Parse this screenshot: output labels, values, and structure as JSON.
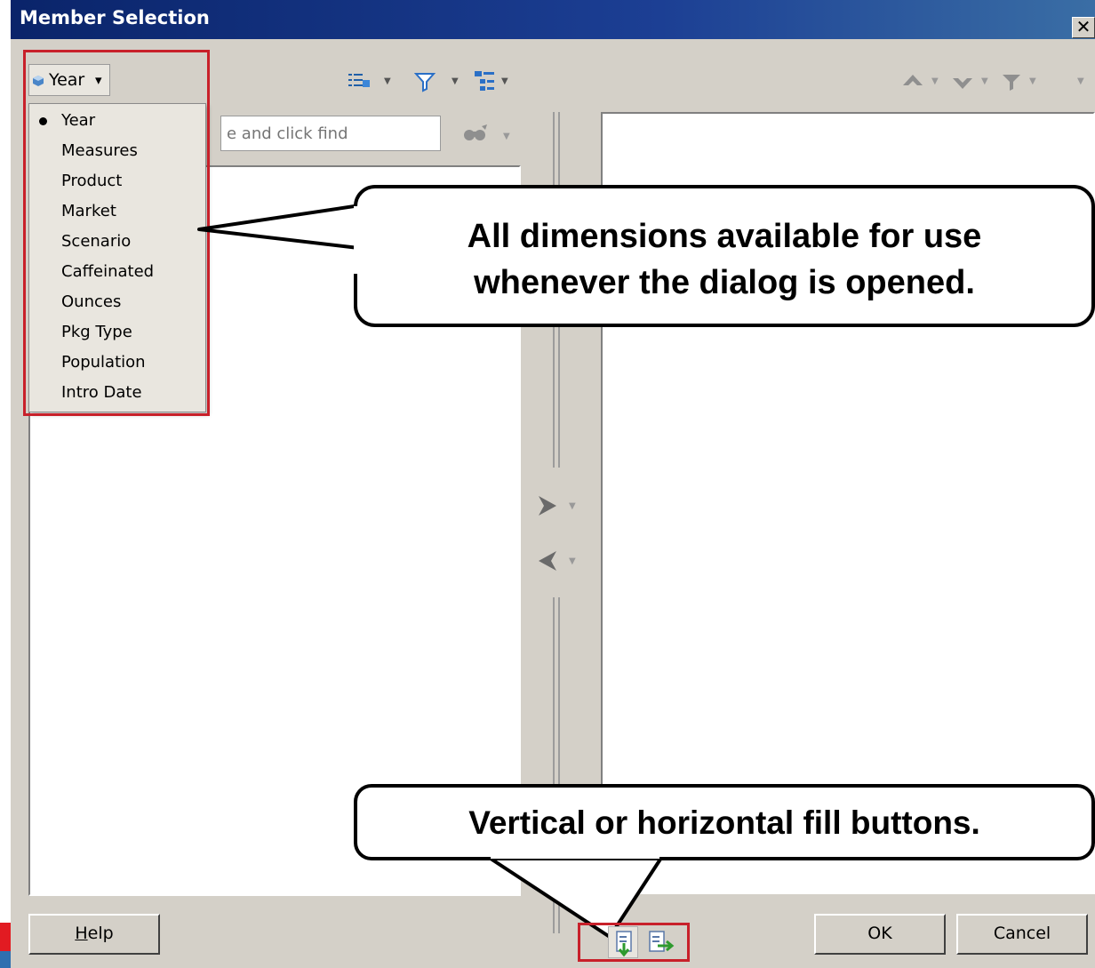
{
  "window": {
    "title": "Member Selection",
    "close_glyph": "✕"
  },
  "toolbar": {
    "dimension_button": "Year",
    "dimension_caret": "▾",
    "left_tools": [
      "view-icon",
      "filter-icon",
      "tree-icon"
    ],
    "right_tools": [
      "move-up-icon",
      "move-down-icon",
      "filter-icon"
    ]
  },
  "search": {
    "placeholder": "e and click find"
  },
  "dimension_menu": {
    "selected": "Year",
    "items": [
      "Year",
      "Measures",
      "Product",
      "Market",
      "Scenario",
      "Caffeinated",
      "Ounces",
      "Pkg Type",
      "Population",
      "Intro Date"
    ]
  },
  "callouts": {
    "dimensions_line1": "All dimensions available for use",
    "dimensions_line2": "whenever the dialog is opened.",
    "fill_buttons": "Vertical or horizontal fill buttons."
  },
  "buttons": {
    "help": "Help",
    "help_mnemonic": "H",
    "help_rest": "elp",
    "ok": "OK",
    "cancel": "Cancel"
  },
  "colors": {
    "highlight": "#c8202a",
    "titlebar": "#0a246a",
    "dialog": "#d4d0c8"
  }
}
